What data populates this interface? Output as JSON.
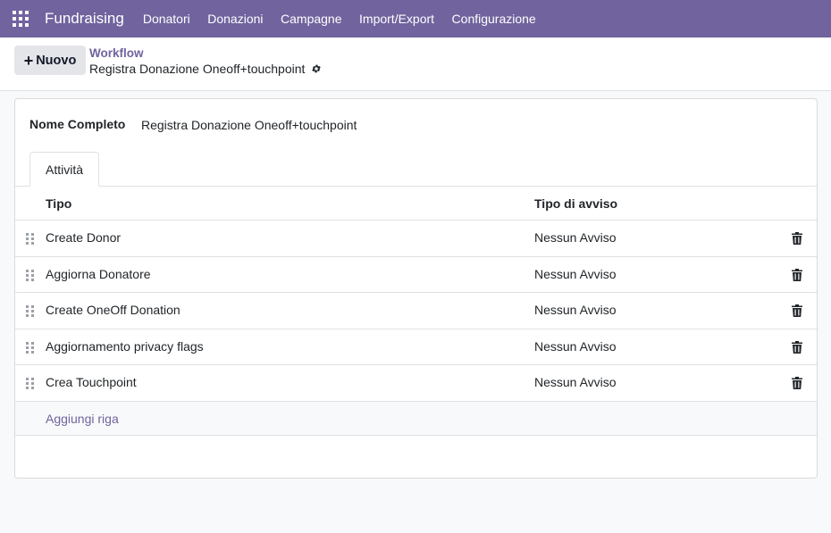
{
  "navbar": {
    "brand": "Fundraising",
    "menu": [
      "Donatori",
      "Donazioni",
      "Campagne",
      "Import/Export",
      "Configurazione"
    ]
  },
  "control_panel": {
    "new_label": "Nuovo",
    "breadcrumb": "Workflow",
    "record_title": "Registra Donazione Oneoff+touchpoint"
  },
  "form": {
    "name_label": "Nome Completo",
    "name_value": "Registra Donazione Oneoff+touchpoint",
    "tab": "Attività"
  },
  "table": {
    "headers": [
      "Tipo",
      "Tipo di avviso"
    ],
    "rows": [
      {
        "tipo": "Create Donor",
        "avviso": "Nessun Avviso"
      },
      {
        "tipo": "Aggiorna Donatore",
        "avviso": "Nessun Avviso"
      },
      {
        "tipo": "Create OneOff Donation",
        "avviso": "Nessun Avviso"
      },
      {
        "tipo": "Aggiornamento privacy flags",
        "avviso": "Nessun Avviso"
      },
      {
        "tipo": "Crea Touchpoint",
        "avviso": "Nessun Avviso"
      }
    ],
    "add_row": "Aggiungi riga"
  },
  "colors": {
    "accent": "#71639e"
  }
}
